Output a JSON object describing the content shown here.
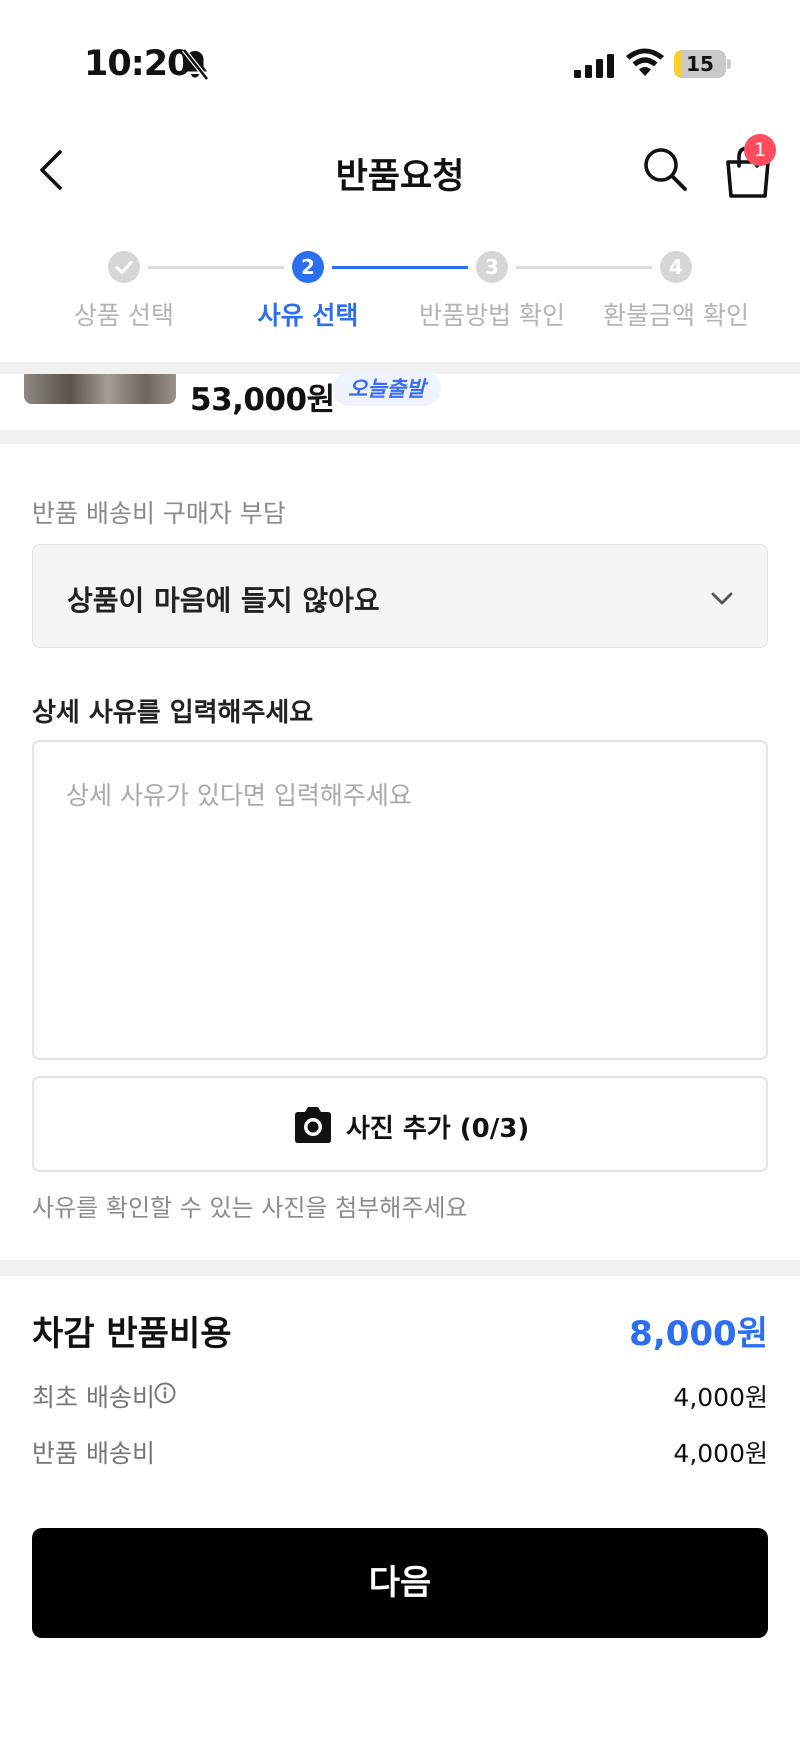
{
  "status_bar": {
    "time": "10:20",
    "battery_level": "15",
    "battery_fraction": 0.15
  },
  "header": {
    "title": "반품요청",
    "cart_count": "1"
  },
  "stepper": {
    "current_step": 2,
    "steps": [
      {
        "number": "✓",
        "label": "상품 선택"
      },
      {
        "number": "2",
        "label": "사유 선택"
      },
      {
        "number": "3",
        "label": "반품방법 확인"
      },
      {
        "number": "4",
        "label": "환불금액 확인"
      }
    ]
  },
  "product": {
    "price": "53,000원",
    "badge": "오늘출발"
  },
  "reason": {
    "shipping_note": "반품 배송비 구매자 부담",
    "selected": "상품이 마음에 들지 않아요",
    "detail_heading": "상세 사유를 입력해주세요",
    "detail_placeholder": "상세 사유가 있다면 입력해주세요",
    "detail_value": "",
    "photo_button": "사진 추가 (0/3)",
    "photo_hint": "사유를 확인할 수 있는 사진을 첨부해주세요"
  },
  "costs": {
    "title": "차감 반품비용",
    "total": "8,000원",
    "rows": [
      {
        "label": "최초 배송비",
        "value": "4,000원"
      },
      {
        "label": "반품 배송비",
        "value": "4,000원"
      }
    ]
  },
  "next_button": "다음",
  "colors": {
    "accent": "#2b6ef0",
    "badge_red": "#ff4d5e",
    "button_black": "#000000"
  }
}
